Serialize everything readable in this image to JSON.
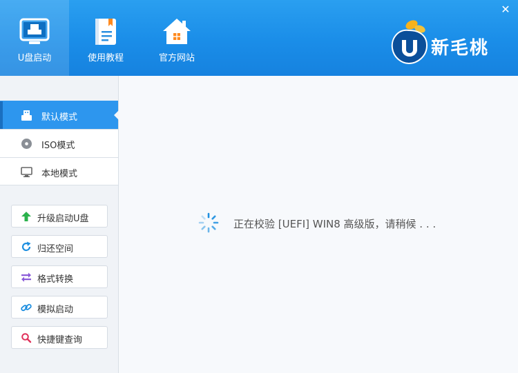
{
  "header": {
    "tabs": [
      {
        "label": "U盘启动",
        "icon": "usb-monitor-icon"
      },
      {
        "label": "使用教程",
        "icon": "book-icon"
      },
      {
        "label": "官方网站",
        "icon": "home-icon"
      }
    ],
    "close": "✕",
    "brand": "新毛桃",
    "logo_letter": "U"
  },
  "sidebar": {
    "modes": [
      {
        "label": "默认模式",
        "icon": "usb-drive-icon"
      },
      {
        "label": "ISO模式",
        "icon": "disc-icon"
      },
      {
        "label": "本地模式",
        "icon": "monitor-icon"
      }
    ],
    "tools": [
      {
        "label": "升级启动U盘",
        "icon": "up-arrow-icon"
      },
      {
        "label": "归还空间",
        "icon": "refresh-icon"
      },
      {
        "label": "格式转换",
        "icon": "swap-arrows-icon"
      },
      {
        "label": "模拟启动",
        "icon": "link-icon"
      },
      {
        "label": "快捷键查询",
        "icon": "search-icon"
      }
    ]
  },
  "main": {
    "status": "正在校验 [UEFI] WIN8 高级版，请稍候 . . ."
  },
  "colors": {
    "header": "#1a8de8",
    "active_mode": "#2d96ee",
    "upgrade_icon": "#2bb24c",
    "refresh_icon": "#1e8fe0",
    "swap_icon": "#8a5ad8",
    "link_icon": "#1e8fe0",
    "search_icon": "#e0305a"
  }
}
